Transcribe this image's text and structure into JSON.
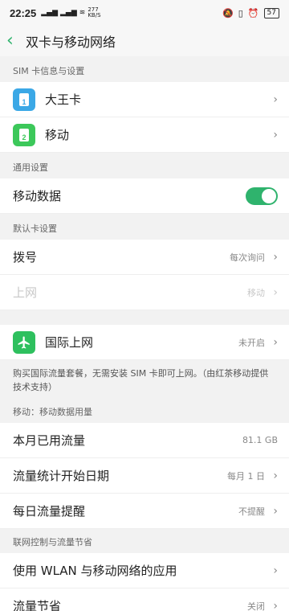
{
  "status_bar": {
    "time": "22:25",
    "speed": "277 KB/S",
    "battery": "57"
  },
  "header": {
    "title": "双卡与移动网络"
  },
  "sections": {
    "sim_info": "SIM 卡信息与设置",
    "general": "通用设置",
    "default_card": "默认卡设置",
    "usage": "移动：移动数据用量",
    "networking": "联网控制与流量节省"
  },
  "sim_cards": [
    {
      "label": "大王卡",
      "badge": "1"
    },
    {
      "label": "移动",
      "badge": "2"
    }
  ],
  "general": {
    "mobile_data_label": "移动数据",
    "mobile_data_on": true
  },
  "default_card": {
    "dial_label": "拨号",
    "dial_value": "每次询问",
    "internet_label": "上网",
    "internet_value": "移动"
  },
  "international": {
    "label": "国际上网",
    "value": "未开启",
    "note": "购买国际流量套餐，无需安装 SIM 卡即可上网。（由红茶移动提供技术支持）"
  },
  "usage": {
    "used_label": "本月已用流量",
    "used_value": "81.1 GB",
    "start_label": "流量统计开始日期",
    "start_value": "每月 1 日",
    "daily_label": "每日流量提醒",
    "daily_value": "不提醒"
  },
  "networking": {
    "apps_label": "使用 WLAN 与移动网络的应用",
    "saver_label": "流量节省",
    "saver_value": "关闭"
  },
  "colors": {
    "accent": "#2fb36d",
    "sim1": "#3ba8e6",
    "sim2": "#3cc85a"
  }
}
